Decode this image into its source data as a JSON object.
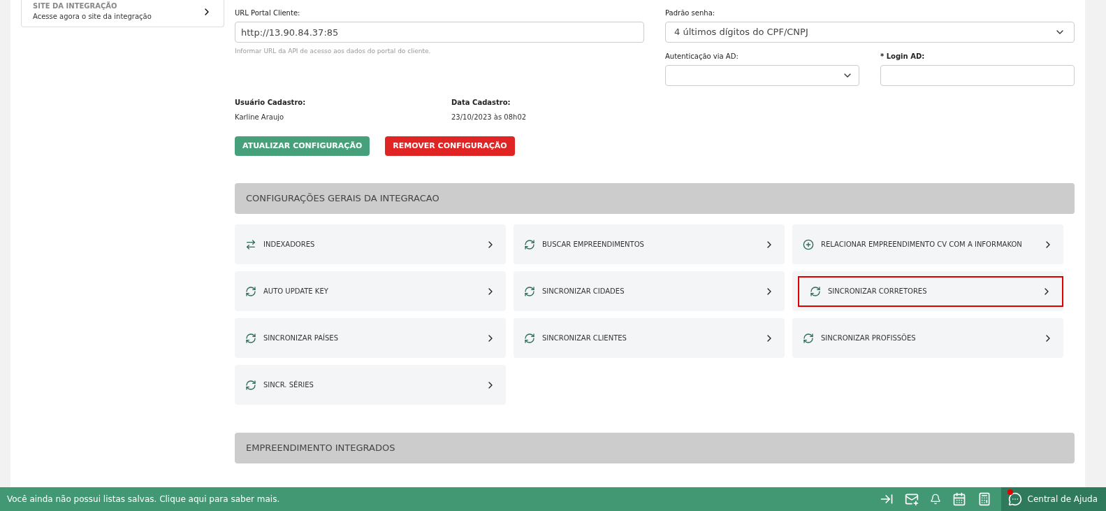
{
  "side_card": {
    "title": "SITE DA INTEGRAÇÃO",
    "subtitle": "Acesse agora o site da integração"
  },
  "form": {
    "url": {
      "label": "URL Portal Cliente:",
      "value": "http://13.90.84.37:85",
      "help": "Informar URL da API de acesso aos dados do portal do cliente."
    },
    "password_pattern": {
      "label": "Padrão senha:",
      "value": "4 últimos dígitos do CPF/CNPJ"
    },
    "ad_auth": {
      "label": "Autenticação via AD:"
    },
    "login_ad": {
      "label": "* Login AD:"
    }
  },
  "meta": [
    {
      "label": "Usuário Cadastro:",
      "value": "Karline Araujo"
    },
    {
      "label": "Data Cadastro:",
      "value": "23/10/2023 às 08h02"
    }
  ],
  "buttons": [
    {
      "label": "ATUALIZAR CONFIGURAÇÃO",
      "kind": "primary"
    },
    {
      "label": "REMOVER CONFIGURAÇÃO",
      "kind": "danger"
    }
  ],
  "general_section": {
    "title": "CONFIGURAÇÕES GERAIS DA INTEGRACAO",
    "items": [
      {
        "label": "INDEXADORES",
        "kind": "arrows",
        "highlighted": false
      },
      {
        "label": "BUSCAR EMPREENDIMENTOS",
        "kind": "sync",
        "highlighted": false
      },
      {
        "label": "RELACIONAR EMPREENDIMENTO CV COM A INFORMAKON",
        "kind": "plus",
        "highlighted": false
      },
      {
        "label": "AUTO UPDATE KEY",
        "kind": "sync",
        "highlighted": false
      },
      {
        "label": "SINCRONIZAR CIDADES",
        "kind": "sync",
        "highlighted": false
      },
      {
        "label": "SINCRONIZAR CORRETORES",
        "kind": "sync",
        "highlighted": true
      },
      {
        "label": "SINCRONIZAR PAÍSES",
        "kind": "sync",
        "highlighted": false
      },
      {
        "label": "SINCRONIZAR CLIENTES",
        "kind": "sync",
        "highlighted": false
      },
      {
        "label": "SINCRONIZAR PROFISSÕES",
        "kind": "sync",
        "highlighted": false
      },
      {
        "label": "SINCR. SÉRIES",
        "kind": "sync",
        "highlighted": false
      }
    ]
  },
  "integrated_section": {
    "title": "EMPREENDIMENTO INTEGRADOS"
  },
  "status_bar": {
    "message": "Você ainda não possui listas salvas. Clique aqui para saber mais.",
    "help": "Central de Ajuda",
    "help_notification": true
  }
}
